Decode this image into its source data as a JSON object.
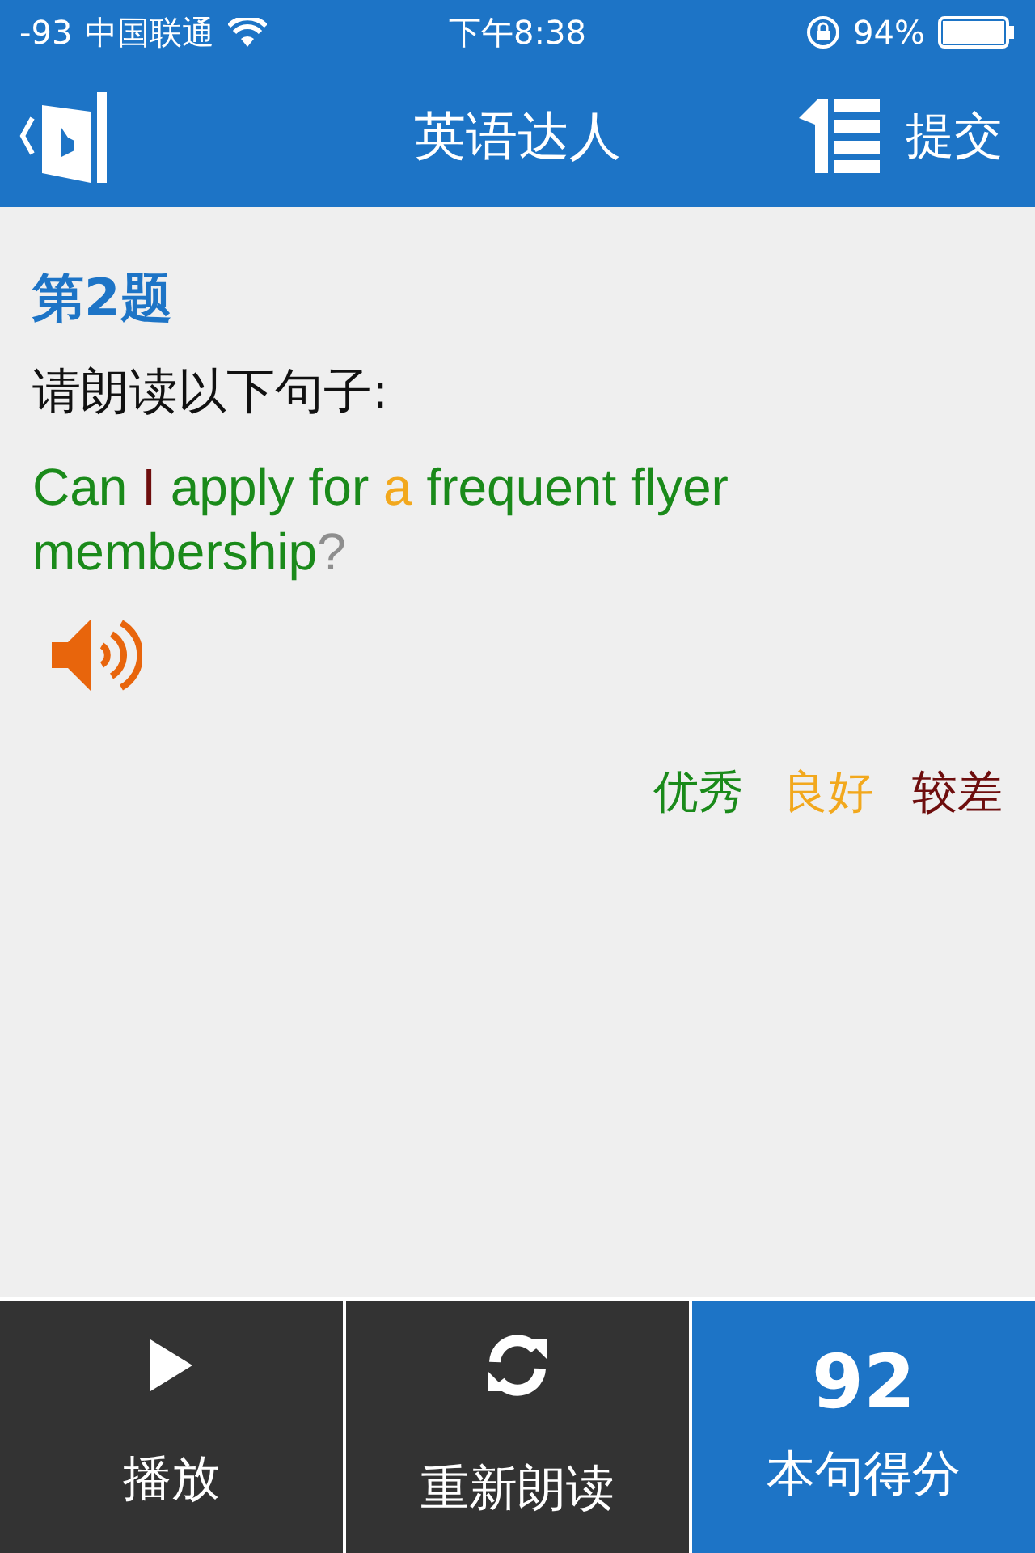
{
  "status_bar": {
    "signal": "-93",
    "carrier": "中国联通",
    "time": "下午8:38",
    "battery": "94%"
  },
  "nav": {
    "title": "英语达人",
    "action": "提交"
  },
  "question": {
    "number": "第2题",
    "prompt": "请朗读以下句子:",
    "segments": [
      {
        "text": "Can ",
        "color": "#1a8a1a"
      },
      {
        "text": "I",
        "color": "#6e0d0d"
      },
      {
        "text": " apply for ",
        "color": "#1a8a1a"
      },
      {
        "text": "a",
        "color": "#f2a81d"
      },
      {
        "text": " frequent flyer membership",
        "color": "#1a8a1a"
      },
      {
        "text": "?",
        "color": "#8e8e8e"
      }
    ]
  },
  "legend": [
    {
      "label": "优秀",
      "color": "#1a8a1a"
    },
    {
      "label": "良好",
      "color": "#f2a81d"
    },
    {
      "label": "较差",
      "color": "#6e0d0d"
    }
  ],
  "toolbar": [
    {
      "kind": "play",
      "label": "播放"
    },
    {
      "kind": "retry",
      "label": "重新朗读"
    },
    {
      "kind": "score",
      "value": "92",
      "label": "本句得分"
    }
  ]
}
